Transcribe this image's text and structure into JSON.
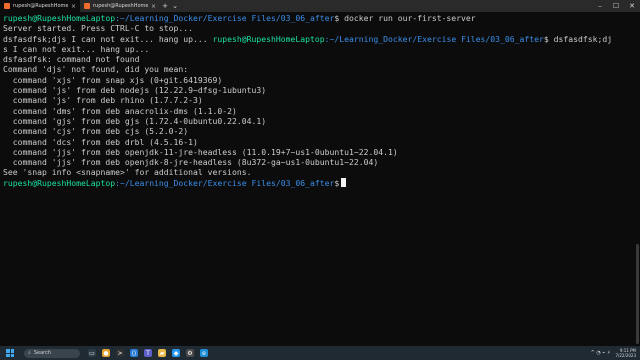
{
  "tabs": [
    {
      "label": "rupesh@RupeshHomeLaptop:",
      "active": true
    },
    {
      "label": "rupesh@RupeshHomeLaptop:",
      "active": false
    }
  ],
  "tab_close": "×",
  "new_tab": "+",
  "tab_dropdown": "⌄",
  "window_controls": {
    "minimize": "–",
    "maximize": "☐",
    "close": "✕"
  },
  "terminal": {
    "prompt_user": "rupesh@RupeshHomeLaptop",
    "prompt_path": ":~/Learning_Docker/Exercise Files/03_06_after",
    "prompt_symbol": "$",
    "line1_cmd": " docker run our-first-server",
    "line2": "Server started. Press CTRL-C to stop...",
    "line3_text": "dsfasdfsk;djs I can not exit... hang up... ",
    "line3_cmd": " dsfasdfsk;dj",
    "line4": "s I can not exit... hang up...",
    "line5": "dsfasdfsk: command not found",
    "line6": "Command 'djs' not found, did you mean:",
    "suggestions": [
      "  command 'xjs' from snap xjs (0+git.6419369)",
      "  command 'js' from deb nodejs (12.22.9~dfsg-1ubuntu3)",
      "  command 'js' from deb rhino (1.7.7.2-3)",
      "  command 'dms' from deb anacrolix-dms (1.1.0-2)",
      "  command 'gjs' from deb gjs (1.72.4-0ubuntu0.22.04.1)",
      "  command 'cjs' from deb cjs (5.2.0-2)",
      "  command 'dcs' from deb drbl (4.5.16-1)",
      "  command 'jjs' from deb openjdk-11-jre-headless (11.0.19+7~us1-0ubuntu1~22.04.1)",
      "  command 'jjs' from deb openjdk-8-jre-headless (8u372-ga~us1-0ubuntu1~22.04)"
    ],
    "line_snap": "See 'snap info <snapname>' for additional versions."
  },
  "taskbar": {
    "search_icon": "⌕",
    "search_placeholder": "Search",
    "apps": [
      {
        "name": "task-view-icon",
        "glyph": "▭",
        "color": "#2b3a45"
      },
      {
        "name": "chrome-icon",
        "glyph": "●",
        "color": "#e0a030"
      },
      {
        "name": "terminal-icon",
        "glyph": ">",
        "color": "#303030"
      },
      {
        "name": "vscode-icon",
        "glyph": "⟨⟩",
        "color": "#2a7bd4"
      },
      {
        "name": "teams-icon",
        "glyph": "T",
        "color": "#5b5fc7"
      },
      {
        "name": "folder-icon",
        "glyph": "▰",
        "color": "#e8b84a"
      },
      {
        "name": "docker-icon",
        "glyph": "◆",
        "color": "#2496ed"
      },
      {
        "name": "settings-icon",
        "glyph": "⚙",
        "color": "#4a4a4a"
      },
      {
        "name": "edge-icon",
        "glyph": "e",
        "color": "#1f8fd8"
      }
    ],
    "tray_icons": "^ ◔ ⌁ ⚡",
    "time": "9:11 PM",
    "date": "7/22/2023"
  },
  "colors": {
    "prompt_green": "#19e0a4",
    "path_blue": "#3b8eea",
    "text": "#cccccc",
    "background": "#0c0c0c"
  }
}
